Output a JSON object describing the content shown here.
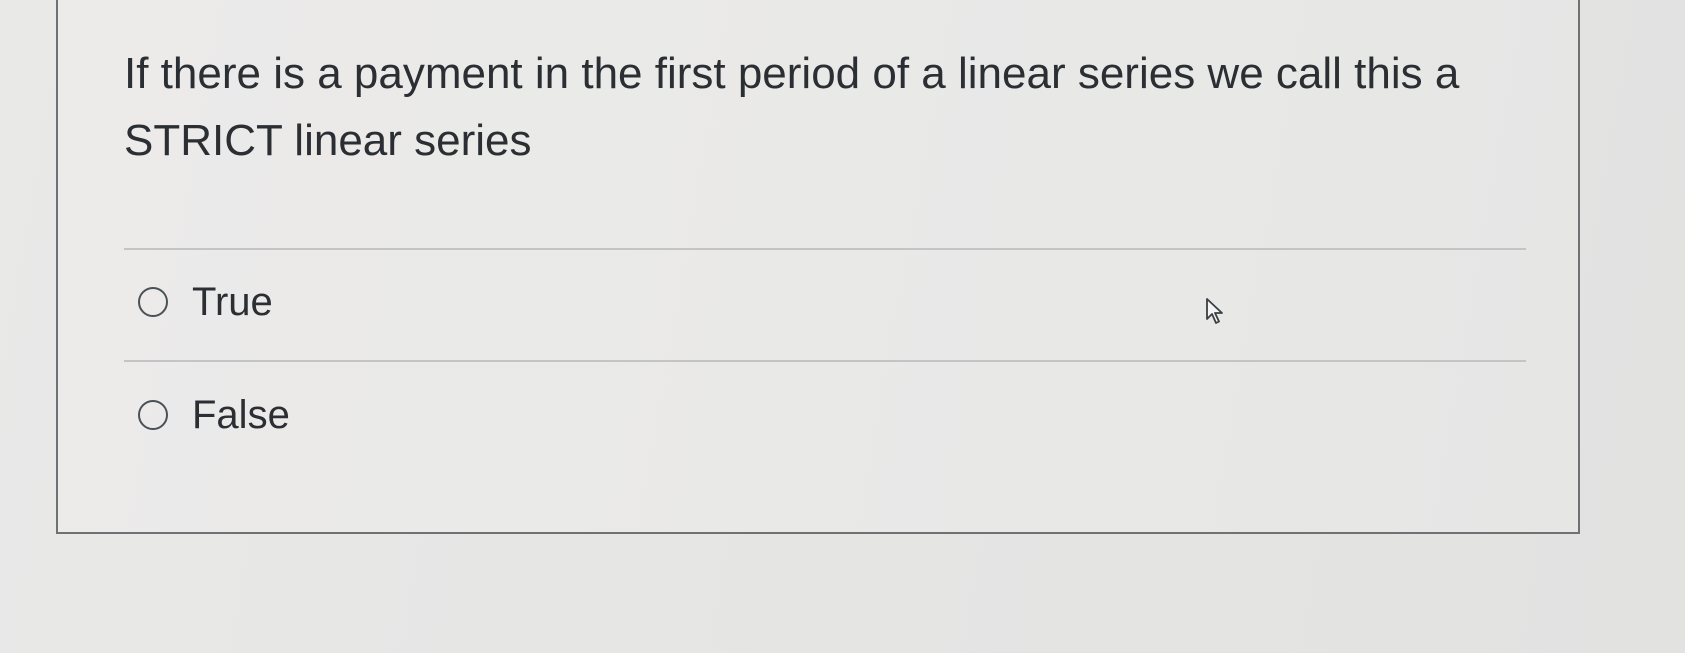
{
  "question": {
    "text": "If there is a payment in the first period of a linear series we call this a STRICT linear series"
  },
  "answers": [
    {
      "label": "True",
      "selected": false
    },
    {
      "label": "False",
      "selected": false
    }
  ],
  "icons": {
    "radio": "radio-unselected-icon",
    "cursor": "mouse-pointer-icon"
  },
  "colors": {
    "border": "#6f7275",
    "text": "#2b2f33",
    "divider": "#c2c4c5"
  }
}
